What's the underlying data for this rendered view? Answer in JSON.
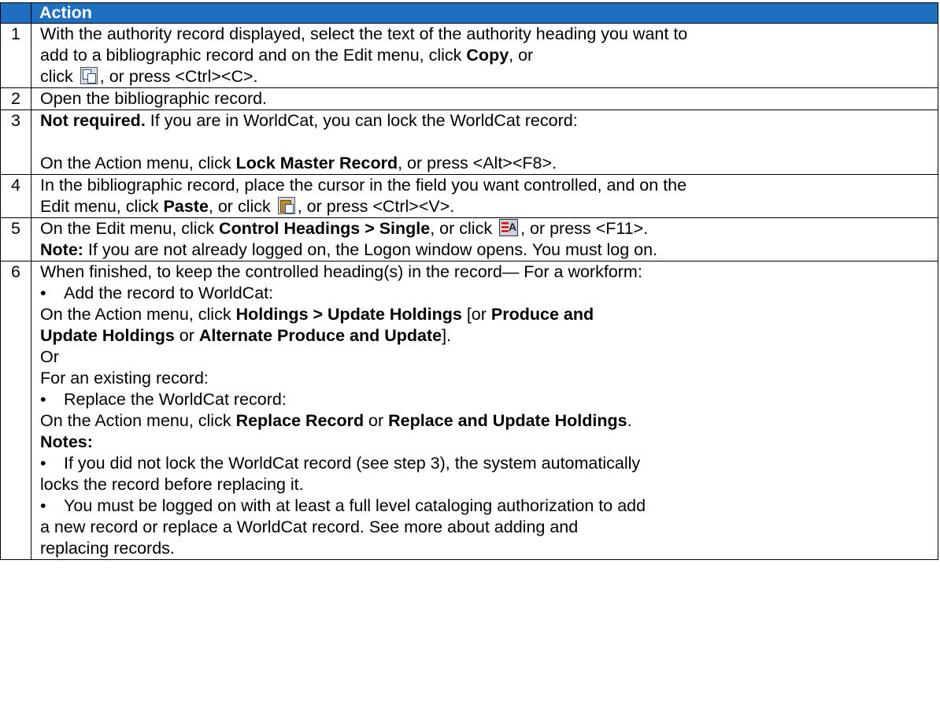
{
  "header": {
    "num": "",
    "action": "Action"
  },
  "steps": {
    "s1": {
      "num": "1",
      "l1": "With the authority record displayed, select the text of the authority heading you want to",
      "l2a": "add to a bibliographic record and on the Edit menu, click ",
      "l2b": "Copy",
      "l2c": ", or",
      "l3a": "click ",
      "l3b": ", or press <Ctrl><C>."
    },
    "s2": {
      "num": "2",
      "l1": "Open the bibliographic record."
    },
    "s3": {
      "num": "3",
      "l1a": "Not required.",
      "l1b": " If you are in WorldCat, you can lock the WorldCat record:",
      "l2a": "On the Action menu, click ",
      "l2b": "Lock Master Record",
      "l2c": ", or press <Alt><F8>."
    },
    "s4": {
      "num": "4",
      "l1": "In the bibliographic record, place the cursor in the field you want controlled, and on the",
      "l2a": "Edit menu, click ",
      "l2b": "Paste",
      "l2c": ", or click ",
      "l2d": ", or press <Ctrl><V>."
    },
    "s5": {
      "num": "5",
      "l1a": "On the Edit menu, click ",
      "l1b": "Control Headings > Single",
      "l1c": ", or click ",
      "l1d": ", or press <F11>.",
      "l2a": "Note:",
      "l2b": " If you are not already logged on, the Logon window opens. You must log on."
    },
    "s6": {
      "num": "6",
      "l1": "When finished, to keep the controlled heading(s) in the record— For a workform:",
      "b1": "Add the record to WorldCat:",
      "b1s1a": "On the Action menu, click ",
      "b1s1b": "Holdings > Update Holdings",
      "b1s1c": " [or ",
      "b1s1d": "Produce and",
      "b1s2a": "Update Holdings",
      "b1s2b": " or ",
      "b1s2c": "Alternate Produce and Update",
      "b1s2d": "].",
      "or": "Or",
      "existing": "For an existing record:",
      "b2": "Replace the WorldCat record:",
      "b2s1a": "On the Action menu, click ",
      "b2s1b": "Replace Record",
      "b2s1c": " or ",
      "b2s1d": "Replace and Update Holdings",
      "b2s1e": ".",
      "notes": "Notes:",
      "n1a": "If you did not lock the WorldCat record (see step 3), the system automatically",
      "n1b": "locks the record before replacing it.",
      "n2a": "You must be logged on with at least a full level cataloging authorization to add",
      "n2b": "a new record or replace a WorldCat record. See more about adding and",
      "n2c": "replacing records."
    }
  },
  "icons": {
    "copy": "copy-icon",
    "paste": "paste-icon",
    "control": "control-headings-icon"
  }
}
